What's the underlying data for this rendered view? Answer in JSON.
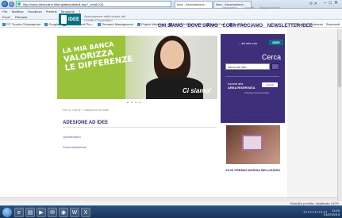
{
  "browser": {
    "address": "http://www.ideeonline.it/templates/default.asp?_vela0=0&...",
    "tabs": [
      {
        "label": "Idee - Associazione..."
      },
      {
        "label": "Idee - Associazione..."
      }
    ],
    "menu": [
      "File",
      "Modifica",
      "Visualizza",
      "Preferiti",
      "Strumenti",
      "?"
    ],
    "favbar_items": [
      "Excel",
      "Rilevanti"
    ],
    "favorites": [
      "FIT Scuola Chiamaporto",
      "Google",
      "Area Dimenti Pro...",
      "Demand Management",
      "Project Web App",
      "ECCRIA BANCA Ext",
      "Portal Prat",
      "RealPlayer"
    ],
    "cmd_tools": [
      "Pagina",
      "Sicurezza",
      "Strumenti"
    ],
    "status_right": "Modalità protetta: disattivata",
    "zoom": "100%"
  },
  "site": {
    "top_links": [
      "Newsletter",
      "Contatti",
      "Mappa del sito"
    ],
    "logo_text": "IDEE",
    "logo_sub": "Associazione delle donne del Credito Cooperativo",
    "nav": [
      "CHI SIAMO",
      "DOVE SIAMO",
      "COSA FACCIAMO",
      "NEWSLETTER IDEE"
    ],
    "hero": {
      "line1": "LA MIA BANCA",
      "line2": "VALORIZZA",
      "line3": "LE DIFFERENZE",
      "caption": "Ci siamo!"
    },
    "dots": "• • • •",
    "breadcrumb": "Sei in: Home > Adesione ad idee",
    "page_title": "ADESIONE AD IDEE",
    "sublinks": [
      "Questionario",
      "Documentazione"
    ],
    "sidebar": {
      "top_text": "... fai rete con",
      "badge": "IDEE",
      "search_label": "Cerca",
      "search_value": "cerca nel sito",
      "area_line1": "Accedi alla",
      "area_line2": "AREA RISERVATA",
      "area_button": "Accedi",
      "area_link": "» Password dimenticata",
      "campaign": "SCARICA LA MINI CAMPAGNA REALIZZATA DA IDEE",
      "bottom": "XXVII PREMIO MARISA BELLISARIO"
    }
  },
  "taskbar": {
    "clock_time": "11:24",
    "clock_date": "01/07/2013"
  }
}
